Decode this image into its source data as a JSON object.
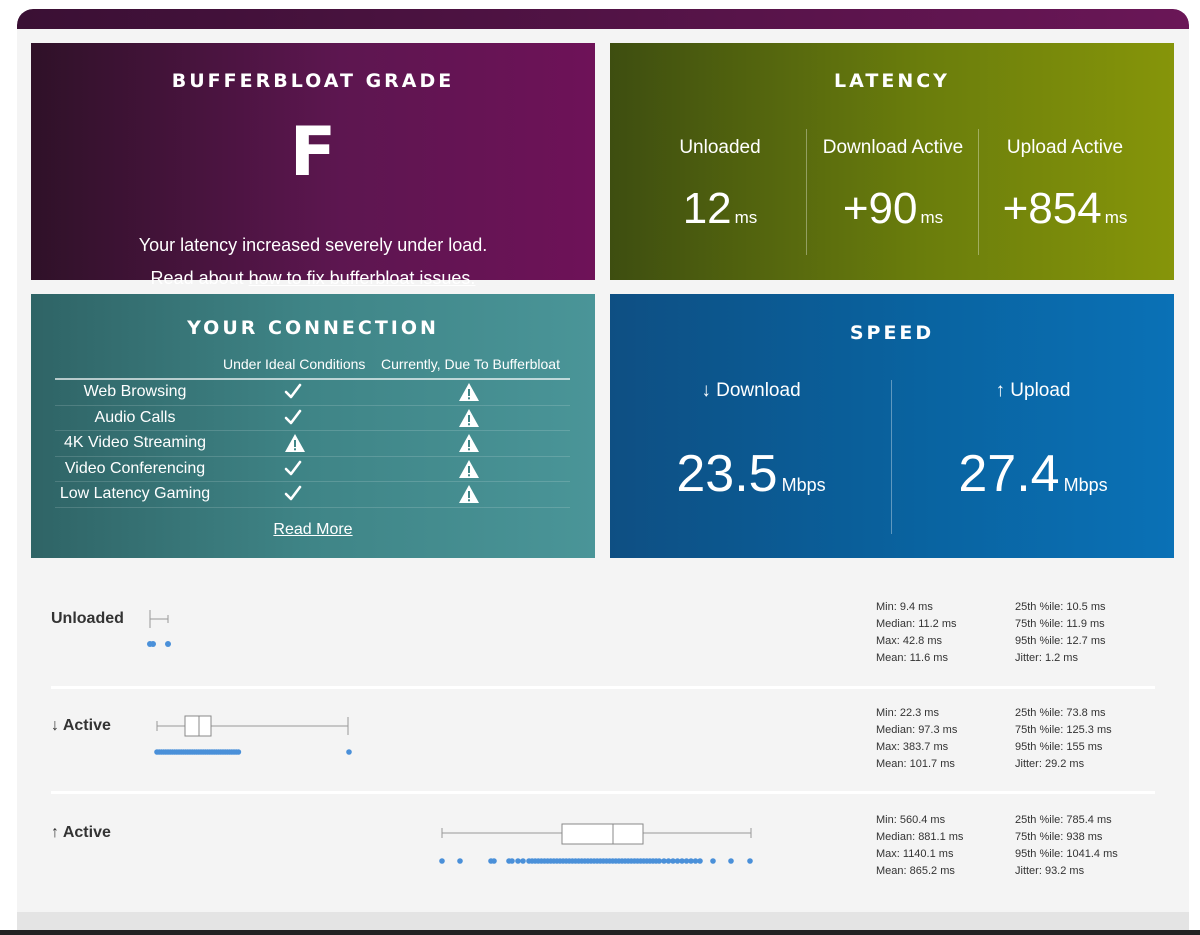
{
  "grade": {
    "title": "BUFFERBLOAT GRADE",
    "letter": "F",
    "message": "Your latency increased severely under load.",
    "fix_prefix": "Read about",
    "fix_link": "how to fix bufferbloat issues."
  },
  "latency": {
    "title": "LATENCY",
    "columns": [
      {
        "label": "Unloaded",
        "value": "12",
        "unit": "ms"
      },
      {
        "label": "Download Active",
        "value": "+90",
        "unit": "ms"
      },
      {
        "label": "Upload Active",
        "value": "+854",
        "unit": "ms"
      }
    ]
  },
  "connection": {
    "title": "YOUR CONNECTION",
    "col_ideal": "Under Ideal Conditions",
    "col_now": "Currently, Due To Bufferbloat",
    "rows": [
      {
        "task": "Web Browsing",
        "ideal": "check",
        "now": "warning"
      },
      {
        "task": "Audio Calls",
        "ideal": "check",
        "now": "warning"
      },
      {
        "task": "4K Video Streaming",
        "ideal": "warning",
        "now": "warning"
      },
      {
        "task": "Video Conferencing",
        "ideal": "check",
        "now": "warning"
      },
      {
        "task": "Low Latency Gaming",
        "ideal": "check",
        "now": "warning"
      }
    ],
    "read_more": "Read More"
  },
  "speed": {
    "title": "SPEED",
    "download": {
      "label": "↓ Download",
      "value": "23.5",
      "unit": "Mbps"
    },
    "upload": {
      "label": "↑ Upload",
      "value": "27.4",
      "unit": "Mbps"
    }
  },
  "stats": [
    {
      "label": "Unloaded",
      "min": "Min: 9.4 ms",
      "median": "Median: 11.2 ms",
      "max": "Max: 42.8 ms",
      "mean": "Mean: 11.6 ms",
      "p25": "25th %ile: 10.5 ms",
      "p75": "75th %ile: 11.9 ms",
      "p95": "95th %ile: 12.7 ms",
      "jitter": "Jitter: 1.2 ms"
    },
    {
      "label": "↓ Active",
      "min": "Min: 22.3 ms",
      "median": "Median: 97.3 ms",
      "max": "Max: 383.7 ms",
      "mean": "Mean: 101.7 ms",
      "p25": "25th %ile: 73.8 ms",
      "p75": "75th %ile: 125.3 ms",
      "p95": "95th %ile: 155 ms",
      "jitter": "Jitter: 29.2 ms"
    },
    {
      "label": "↑ Active",
      "min": "Min: 560.4 ms",
      "median": "Median: 881.1 ms",
      "max": "Max: 1140.1 ms",
      "mean": "Mean: 865.2 ms",
      "p25": "25th %ile: 785.4 ms",
      "p75": "75th %ile: 938 ms",
      "p95": "95th %ile: 1041.4 ms",
      "jitter": "Jitter: 93.2 ms"
    }
  ],
  "colors": {
    "grade_bg": "#5d1650",
    "latency_bg": "#6a7d0c",
    "connection_bg": "#3f8587",
    "speed_bg": "#0963a0",
    "dot": "#4a90d9"
  }
}
